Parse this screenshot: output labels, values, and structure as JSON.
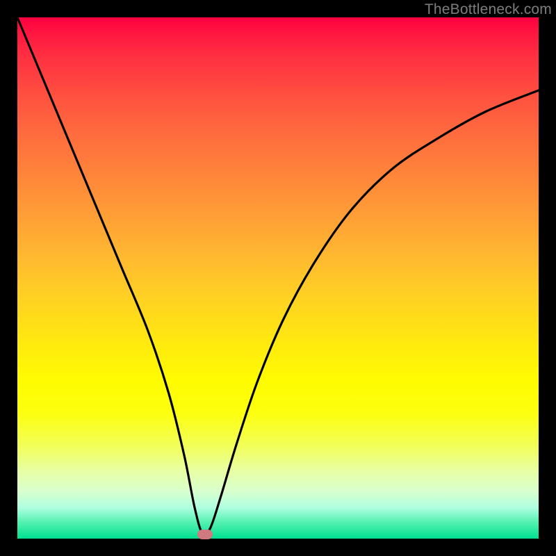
{
  "watermark": "TheBottleneck.com",
  "chart_data": {
    "type": "line",
    "title": "",
    "xlabel": "",
    "ylabel": "",
    "xlim": [
      0,
      100
    ],
    "ylim": [
      0,
      100
    ],
    "grid": false,
    "series": [
      {
        "name": "bottleneck-curve",
        "x": [
          0,
          5,
          10,
          15,
          20,
          25,
          29,
          32,
          34,
          35.5,
          37,
          39,
          42,
          46,
          51,
          57,
          64,
          72,
          81,
          90,
          100
        ],
        "y": [
          100,
          88,
          76,
          64,
          52,
          40,
          28,
          16,
          6,
          1,
          2,
          8,
          18,
          30,
          42,
          53,
          63,
          71,
          77,
          82,
          86
        ]
      }
    ],
    "marker": {
      "x": 36,
      "y": 0.8,
      "color": "#cf7a7f"
    },
    "background_gradient": {
      "top": "#ff0040",
      "mid": "#fffc00",
      "bottom": "#00e090"
    }
  }
}
